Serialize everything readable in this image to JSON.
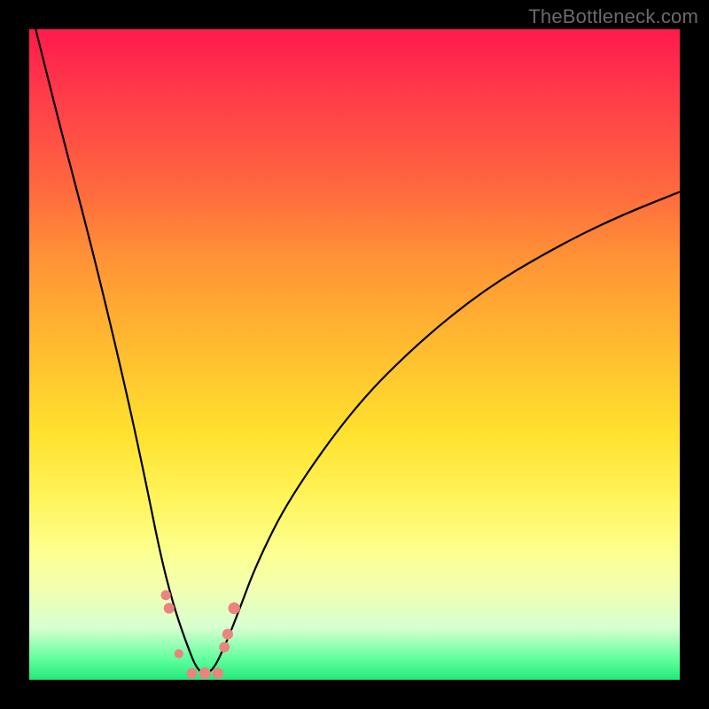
{
  "watermark": "TheBottleneck.com",
  "colors": {
    "frame": "#000000",
    "curve": "#000000",
    "marker_fill": "#e9857e",
    "marker_stroke": "#d86e67"
  },
  "chart_data": {
    "type": "line",
    "title": "",
    "xlabel": "",
    "ylabel": "",
    "xlim": [
      0,
      100
    ],
    "ylim": [
      0,
      100
    ],
    "note": "Axes are implicit (no ticks/labels shown). x ≈ relative hardware position, y ≈ bottleneck %. Curve reaches ~0 near x≈27 and rises on both sides.",
    "series": [
      {
        "name": "bottleneck-curve",
        "x": [
          1,
          5,
          10,
          15,
          18,
          20,
          22,
          24,
          26,
          28,
          30,
          32,
          35,
          40,
          50,
          60,
          70,
          80,
          90,
          100
        ],
        "values": [
          100,
          84,
          65,
          44,
          30,
          20,
          12,
          6,
          1,
          1,
          5,
          10,
          18,
          28,
          42,
          52,
          60,
          66,
          71,
          75
        ]
      }
    ],
    "markers": {
      "name": "highlight-points",
      "x": [
        21,
        21.5,
        23,
        25,
        27,
        29,
        30,
        30.5,
        31.5
      ],
      "values": [
        13,
        11,
        4,
        1,
        1,
        1,
        5,
        7,
        11
      ]
    },
    "gradient_scale": {
      "description": "background vertical gradient maps y (bottleneck %) to color: high=red, mid=yellow, low=green",
      "stops": [
        {
          "y": 100,
          "color": "#ff1a4d"
        },
        {
          "y": 50,
          "color": "#ffb930"
        },
        {
          "y": 20,
          "color": "#fff45a"
        },
        {
          "y": 5,
          "color": "#d6ffd0"
        },
        {
          "y": 0,
          "color": "#23e87b"
        }
      ]
    }
  }
}
